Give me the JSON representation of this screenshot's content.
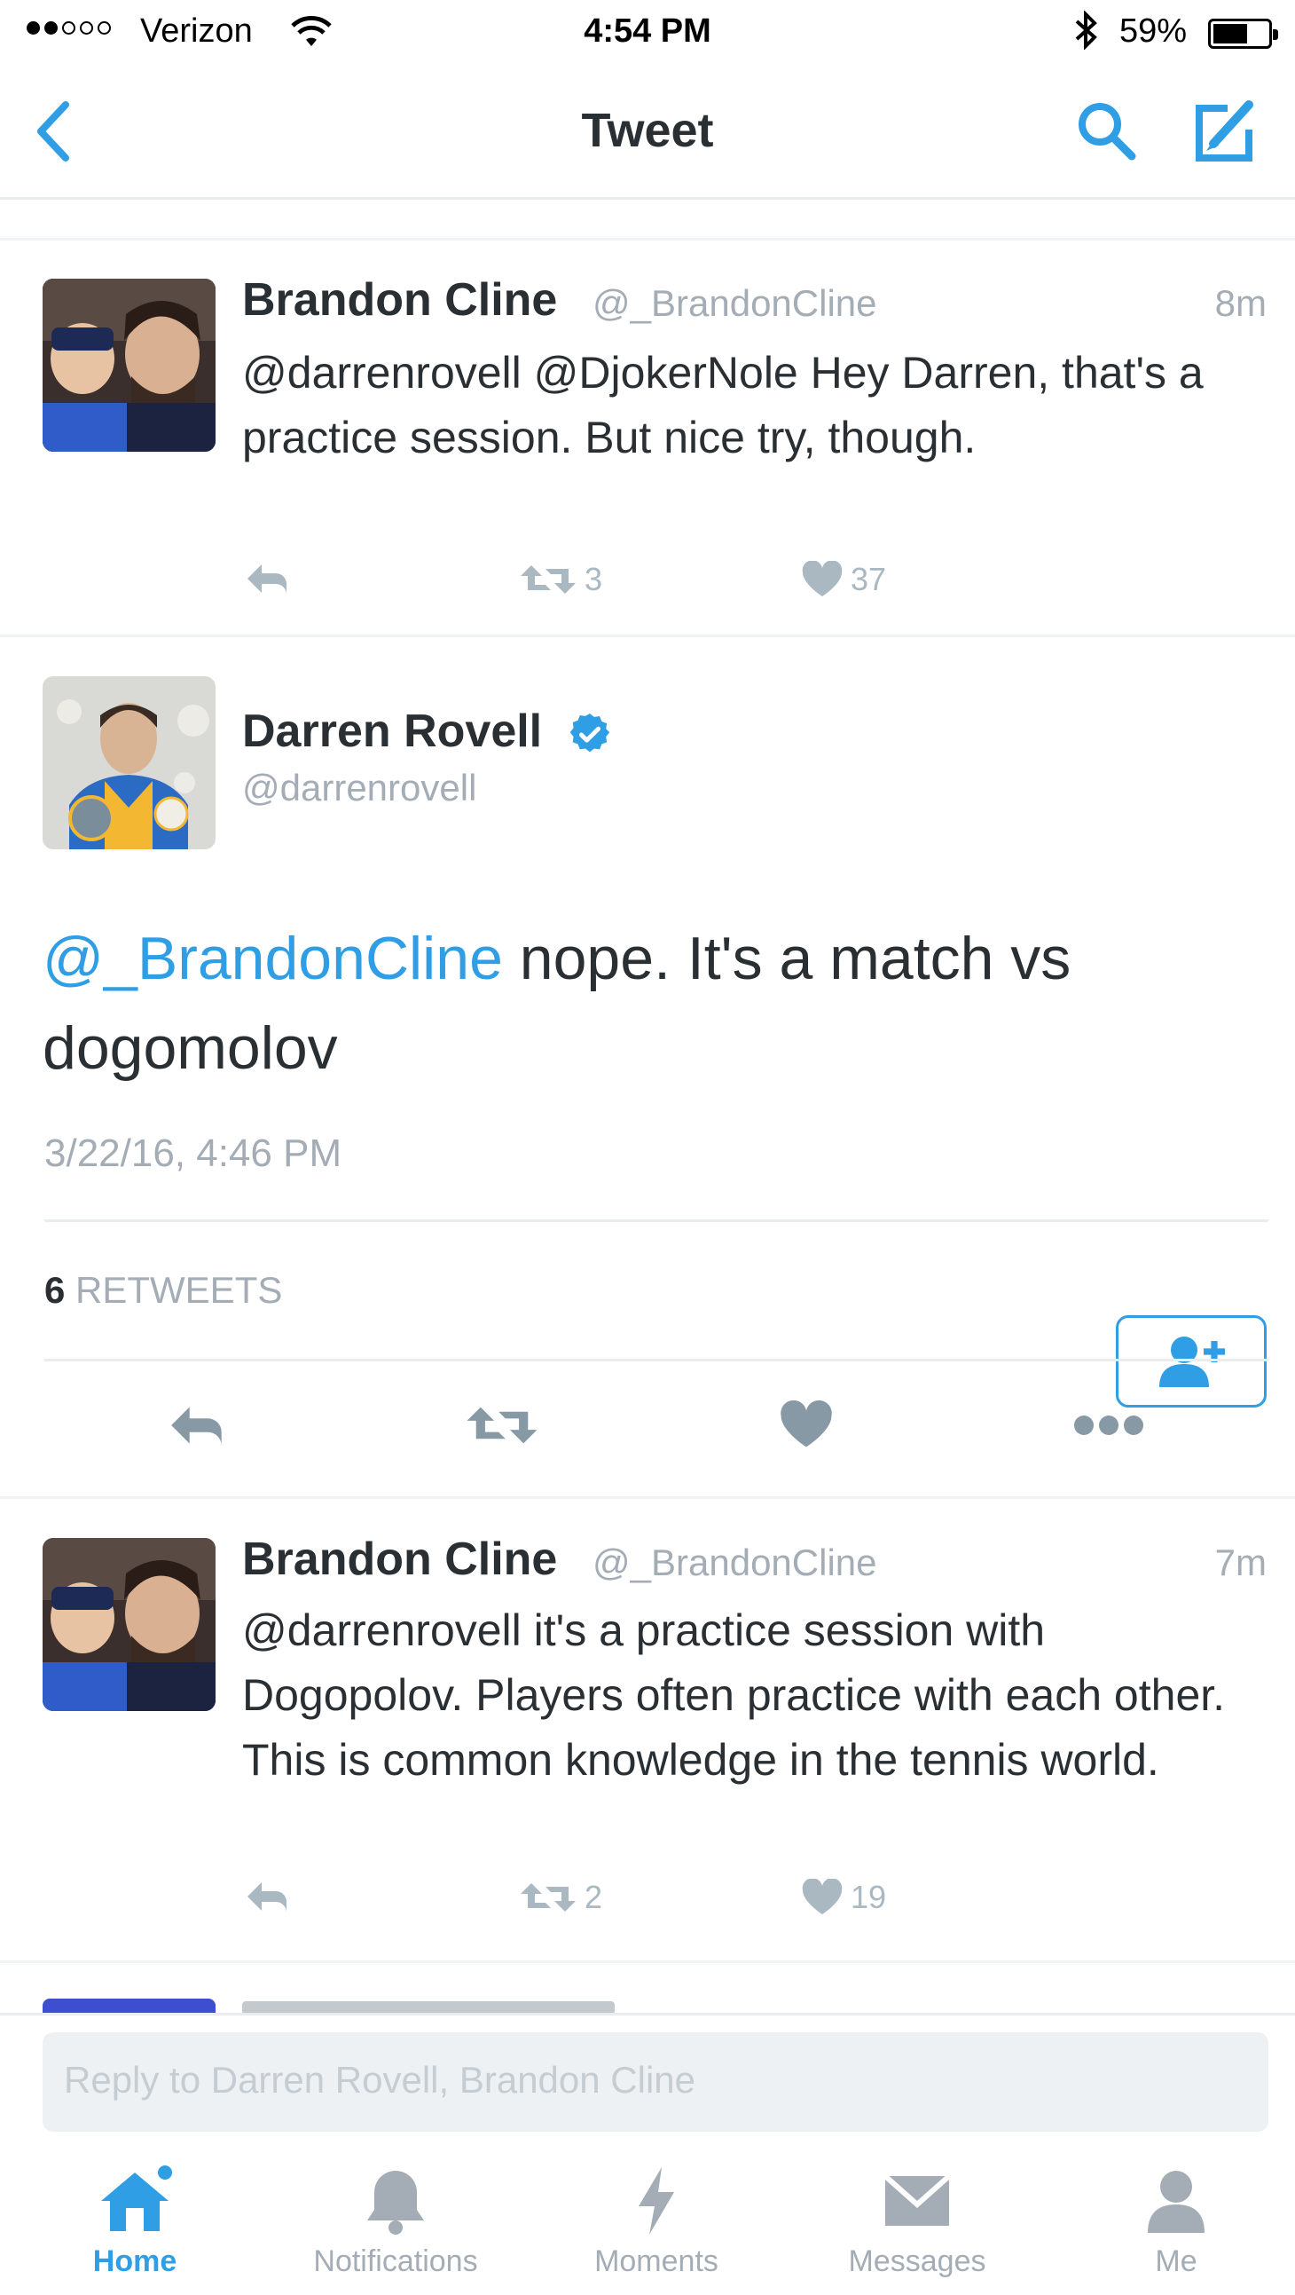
{
  "status_bar": {
    "carrier": "Verizon",
    "time": "4:54 PM",
    "battery_percent": "59%",
    "signal_bars_filled": 2,
    "signal_bars_total": 5,
    "battery_level": 0.59
  },
  "nav": {
    "title": "Tweet",
    "back_icon": "chevron-left-icon",
    "search_icon": "search-icon",
    "compose_icon": "compose-icon"
  },
  "reply_above": {
    "name": "Brandon Cline",
    "handle": "@_BrandonCline",
    "time": "8m",
    "text": "@darrenrovell @DjokerNole Hey Darren, that's a practice session. But nice try, though.",
    "retweets": "3",
    "likes": "37"
  },
  "main_tweet": {
    "name": "Darren Rovell",
    "handle": "@darrenrovell",
    "mention": "@_BrandonCline",
    "text": " nope. It's a match vs dogomolov",
    "date": "3/22/16, 4:46 PM",
    "retweet_count": "6",
    "retweets_label": "RETWEETS"
  },
  "reply_below": {
    "name": "Brandon Cline",
    "handle": "@_BrandonCline",
    "time": "7m",
    "text": "@darrenrovell it's a practice session with Dogopolov. Players often practice with each other. This is common knowledge in the tennis world.",
    "retweets": "2",
    "likes": "19"
  },
  "reply_input": {
    "placeholder": "Reply to Darren Rovell, Brandon Cline"
  },
  "tabs": [
    {
      "label": "Home",
      "icon": "home-icon",
      "active": true
    },
    {
      "label": "Notifications",
      "icon": "bell-icon",
      "active": false
    },
    {
      "label": "Moments",
      "icon": "lightning-icon",
      "active": false
    },
    {
      "label": "Messages",
      "icon": "envelope-icon",
      "active": false
    },
    {
      "label": "Me",
      "icon": "person-icon",
      "active": false
    }
  ],
  "colors": {
    "accent": "#2f9ee4",
    "text": "#292f33",
    "muted": "#a4adb5",
    "divider": "#e9edf0"
  }
}
